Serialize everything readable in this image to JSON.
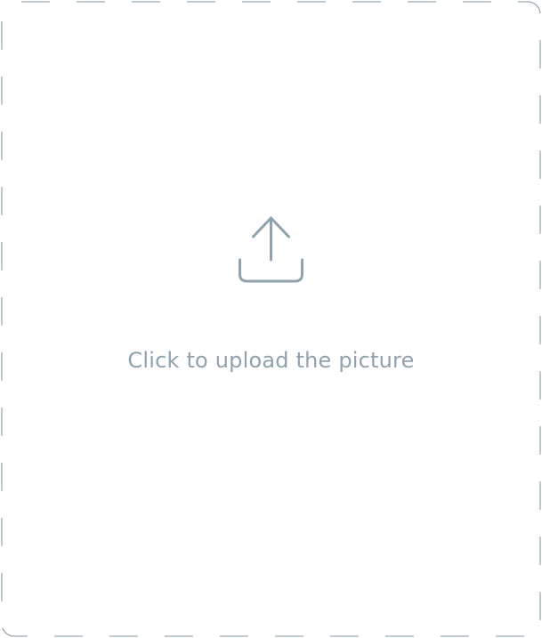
{
  "upload": {
    "label": "Click to upload the picture",
    "icon": "upload-icon"
  },
  "colors": {
    "border": "#98a9b3",
    "icon": "#8fa2ad",
    "text": "#8fa2ad",
    "background": "#ffffff"
  }
}
